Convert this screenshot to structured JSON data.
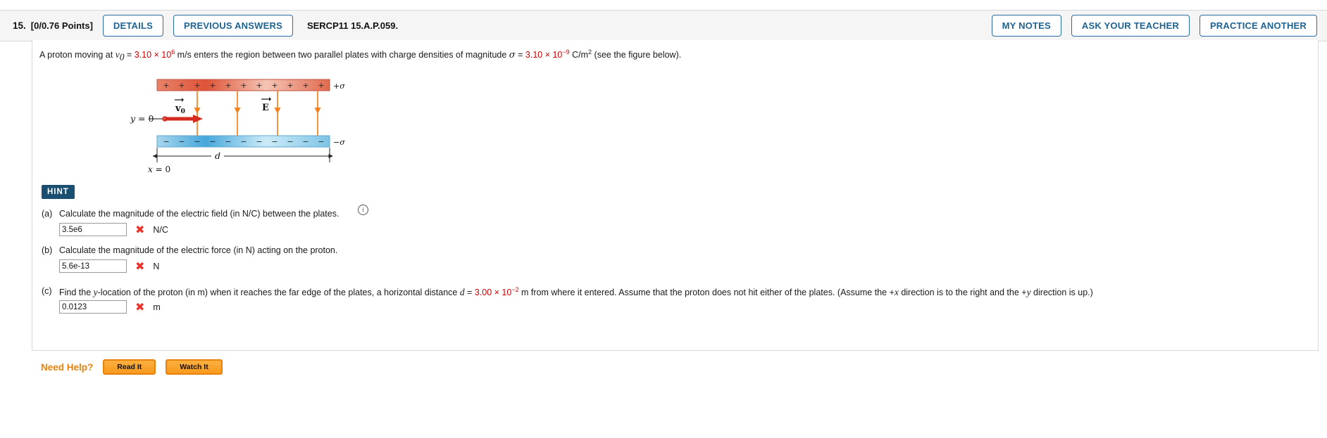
{
  "header": {
    "question_number": "15.",
    "points": "[0/0.76 Points]",
    "details_label": "DETAILS",
    "previous_answers_label": "PREVIOUS ANSWERS",
    "problem_code": "SERCP11 15.A.P.059.",
    "my_notes_label": "MY NOTES",
    "ask_teacher_label": "ASK YOUR TEACHER",
    "practice_another_label": "PRACTICE ANOTHER"
  },
  "statement": {
    "p1": "A proton moving at ",
    "v_symbol": "v",
    "v_sub": "0",
    "eq1": " = ",
    "v_value_mantissa": "3.10 × 10",
    "v_value_exp": "6",
    "p2": " m/s enters the region between two parallel plates with charge densities of magnitude ",
    "sigma_symbol": "σ",
    "eq2": " = ",
    "sigma_value_mantissa": "3.10 × 10",
    "sigma_value_exp": "−9",
    "p3": " C/m",
    "p3_exp": "2",
    "p4": " (see the figure below)."
  },
  "figure": {
    "top_plate_sign": "+",
    "bottom_plate_sign": "−",
    "top_plate_label_sign": "+",
    "top_plate_label_symbol": "σ",
    "bottom_plate_label_sign": "−",
    "bottom_plate_label_symbol": "σ",
    "y_label": "y = 0",
    "v0_label": "v",
    "v0_sub": "0",
    "e_label": "E",
    "d_label": "d",
    "x_label": "x = 0",
    "num_plate_signs": 11,
    "num_field_lines": 4,
    "colors": {
      "top_plate": "#e05c44",
      "bottom_plate": "#59b0dd",
      "field_line": "#f58220",
      "velocity_arrow": "#d52b1e"
    },
    "info_icon": "i"
  },
  "hint": {
    "label": "HINT"
  },
  "parts": [
    {
      "letter": "(a)",
      "text": "Calculate the magnitude of the electric field (in N/C) between the plates.",
      "answer": "3.5e6",
      "status": "✖",
      "unit": "N/C"
    },
    {
      "letter": "(b)",
      "text": "Calculate the magnitude of the electric force (in N) acting on the proton.",
      "answer": "5.6e-13",
      "status": "✖",
      "unit": "N"
    },
    {
      "letter": "(c)",
      "text_a": "Find the ",
      "text_y": "y",
      "text_b": "-location of the proton (in m) when it reaches the far edge of the plates, a horizontal distance ",
      "text_d": "d",
      "text_eq": " = ",
      "d_value_mantissa": "3.00 × 10",
      "d_value_exp": "−2",
      "text_c": " m from where it entered. Assume that the proton does not hit either of the plates. (Assume the +",
      "text_x": "x",
      "text_d2": " direction is to the right and the +",
      "text_y2": "y",
      "text_e": " direction is up.)",
      "answer": "0.0123",
      "status": "✖",
      "unit": "m"
    }
  ],
  "need_help": {
    "label": "Need Help?",
    "read_it": "Read It",
    "watch_it": "Watch It"
  },
  "colors": {
    "accent_blue": "#1f6392",
    "hint_navy": "#1b4f72",
    "orange": "#e8820c",
    "red_value": "#cc0000",
    "error_red": "#e8342c"
  }
}
